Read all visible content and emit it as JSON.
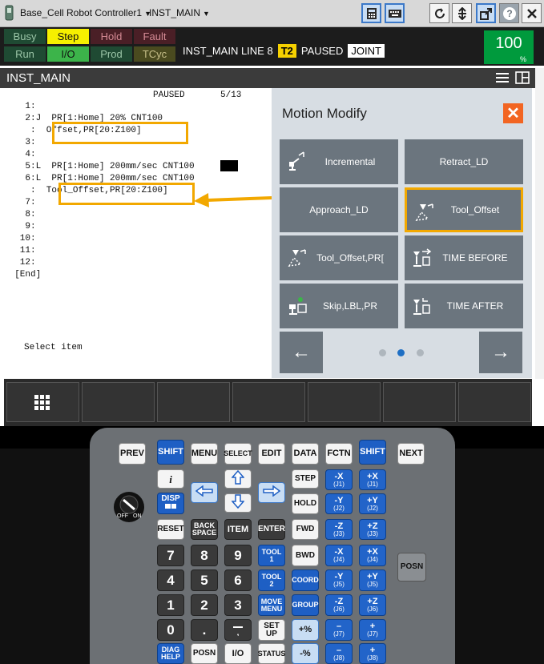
{
  "topbar": {
    "cell": "Base_Cell",
    "controller": "Robot Controller1",
    "program": "INST_MAIN",
    "icons": [
      "calculator-icon",
      "keyboard-icon",
      "refresh-icon",
      "sort-icon",
      "external-link-icon",
      "help-icon",
      "close-icon"
    ]
  },
  "status": {
    "busy": "Busy",
    "step": "Step",
    "hold": "Hold",
    "fault": "Fault",
    "run": "Run",
    "io": "I/O",
    "prod": "Prod",
    "tcyc": "TCyc",
    "program_line": "INST_MAIN LINE 8",
    "mode": "T2",
    "state": "PAUSED",
    "coord": "JOINT",
    "override": "100",
    "override_unit": "%",
    "colors": {
      "step_bg": "#f6f000",
      "io_bg": "#3cb44a",
      "override_bg": "#009a3d",
      "t2_bg": "#f6d100"
    }
  },
  "title": "INST_MAIN",
  "program": {
    "header_state": "PAUSED",
    "header_pos": "5/13",
    "lines": [
      "    1:",
      "    2:J  PR[1:Home] 20% CNT100",
      "     :  Offset,PR[20:Z100]",
      "    3:",
      "    4:",
      "    5:L  PR[1:Home] 200mm/sec CNT100",
      "    6:L  PR[1:Home] 200mm/sec CNT100",
      "     :  Tool_Offset,PR[20:Z100]",
      "    7:",
      "    8:",
      "    9:",
      "   10:",
      "   11:",
      "   12:",
      "  [End]"
    ],
    "prompt": "Select item"
  },
  "motion_modify": {
    "title": "Motion Modify",
    "buttons": [
      {
        "label": "Incremental",
        "icon": "incremental-icon"
      },
      {
        "label": "Retract_LD",
        "icon": ""
      },
      {
        "label": "Approach_LD",
        "icon": ""
      },
      {
        "label": "Tool_Offset",
        "icon": "tool-offset-icon"
      },
      {
        "label": "Tool_Offset,PR[",
        "icon": "tool-offset-pr-icon"
      },
      {
        "label": "TIME BEFORE",
        "icon": "time-before-icon"
      },
      {
        "label": "Skip,LBL,PR",
        "icon": "skip-icon"
      },
      {
        "label": "TIME AFTER",
        "icon": "time-after-icon"
      }
    ],
    "page_current": 2,
    "page_count": 3,
    "prev_icon": "arrow-left-icon",
    "next_icon": "arrow-right-icon"
  },
  "softkeys": {
    "menu_icon": "grid-icon"
  },
  "pendant": {
    "row1": [
      "PREV",
      "SHIFT",
      "MENU",
      "SELECT",
      "EDIT",
      "DATA",
      "FCTN",
      "SHIFT",
      "NEXT"
    ],
    "info": "i",
    "disp": "DISP",
    "reset": "RESET",
    "backspace": "BACK SPACE",
    "item": "ITEM",
    "enter": "ENTER",
    "step": "STEP",
    "hold": "HOLD",
    "fwd": "FWD",
    "bwd": "BWD",
    "coord": "COORD",
    "group": "GROUP",
    "tool1": "TOOL 1",
    "tool2": "TOOL 2",
    "move_menu": "MOVE MENU",
    "set_up": "SET UP",
    "plus_pct": "+%",
    "minus_pct": "-%",
    "diag_help": "DIAG HELP",
    "posn": "POSN",
    "io": "I/O",
    "status": "STATUS",
    "posn_side": "POSN",
    "digits": [
      "7",
      "8",
      "9",
      "4",
      "5",
      "6",
      "1",
      "2",
      "3",
      "0",
      "."
    ],
    "jog": [
      {
        "label": "-X",
        "sub": "(J1)"
      },
      {
        "label": "+X",
        "sub": "(J1)"
      },
      {
        "label": "-Y",
        "sub": "(J2)"
      },
      {
        "label": "+Y",
        "sub": "(J2)"
      },
      {
        "label": "-Z",
        "sub": "(J3)"
      },
      {
        "label": "+Z",
        "sub": "(J3)"
      },
      {
        "label": "-X",
        "sub": "(J4)"
      },
      {
        "label": "+X",
        "sub": "(J4)"
      },
      {
        "label": "-Y",
        "sub": "(J5)"
      },
      {
        "label": "+Y",
        "sub": "(J5)"
      },
      {
        "label": "-Z",
        "sub": "(J6)"
      },
      {
        "label": "+Z",
        "sub": "(J6)"
      },
      {
        "label": "–",
        "sub": "(J7)"
      },
      {
        "label": "+",
        "sub": "(J7)"
      },
      {
        "label": "–",
        "sub": "(J8)"
      },
      {
        "label": "+",
        "sub": "(J8)"
      }
    ],
    "switch_off": "OFF",
    "switch_on": "ON"
  }
}
